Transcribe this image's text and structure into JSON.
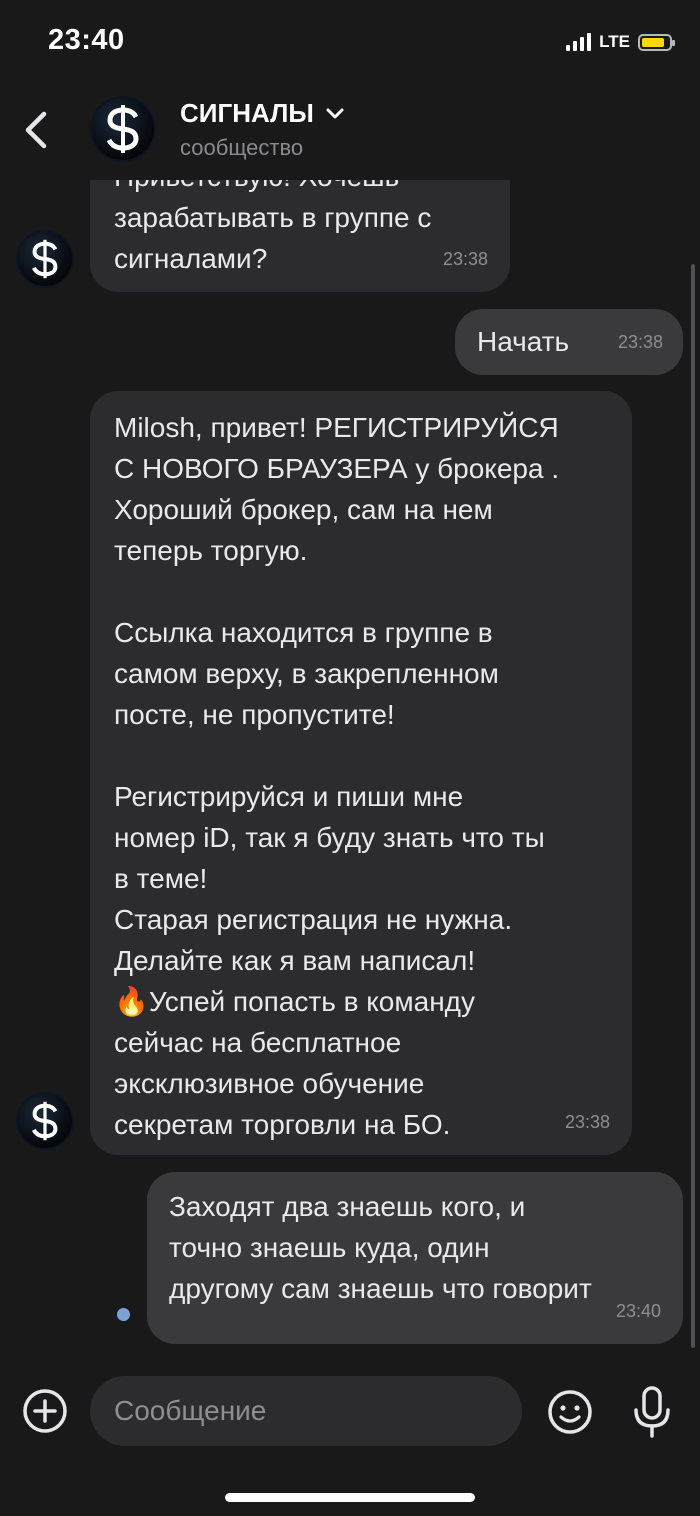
{
  "status_bar": {
    "time": "23:40",
    "network": "LTE"
  },
  "header": {
    "title": "СИГНАЛЫ",
    "subtitle": "сообщество"
  },
  "messages": [
    {
      "direction": "in",
      "lines": [
        "Приветствую! Хочешь",
        "зарабатывать в группе с",
        "сигналами?"
      ],
      "time": "23:38"
    },
    {
      "direction": "out",
      "lines": [
        "Начать"
      ],
      "time": "23:38"
    },
    {
      "direction": "in",
      "lines": [
        "Milosh, привет! РЕГИСТРИРУЙСЯ",
        "С НОВОГО БРАУЗЕРА у брокера .",
        "Хороший брокер, сам на нем",
        "теперь торгую.",
        "",
        "Ссылка находится в группе в",
        "самом верху, в закрепленном",
        "посте, не пропустите!",
        "",
        "Регистрируйся и пиши мне",
        "номер iD, так я буду знать что ты",
        "в теме!",
        "Старая регистрация не нужна.",
        "Делайте как я вам написал!",
        "🔥Успей попасть в команду",
        "сейчас на бесплатное",
        "эксклюзивное обучение",
        "секретам торговли на БО."
      ],
      "time": "23:38"
    },
    {
      "direction": "out",
      "lines": [
        "Заходят два знаешь кого, и",
        "точно знаешь куда, один",
        "другому сам знаешь что говорит"
      ],
      "time": "23:40"
    }
  ],
  "composer": {
    "placeholder": "Сообщение"
  },
  "colors": {
    "background": "#19191a",
    "incoming_bubble": "#2c2c2e",
    "outgoing_bubble": "#3a3a3c",
    "battery": "#ffd60a",
    "unread_dot": "#7ba3d8"
  },
  "icons": [
    "back-chevron-icon",
    "dollar-logo-icon",
    "chevron-down-icon",
    "plus-circle-icon",
    "emoji-icon",
    "microphone-icon"
  ]
}
